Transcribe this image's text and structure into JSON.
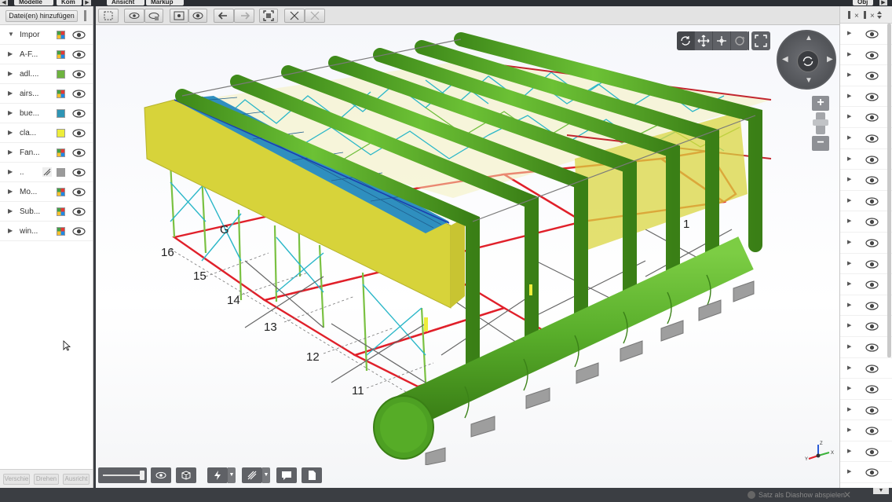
{
  "top_tabs": {
    "left_tab": "Modelle",
    "left_tab2": "Kom",
    "view_tab": "Ansicht",
    "markup_tab": "Markup",
    "right_tab": "Obj"
  },
  "left_panel": {
    "add_files_label": "Datei(en) hinzufügen",
    "items": [
      {
        "label": "Impor",
        "expanded": true,
        "swatch": "multi",
        "color": ""
      },
      {
        "label": "A-F...",
        "expanded": false,
        "swatch": "multi",
        "color": ""
      },
      {
        "label": "adl....",
        "expanded": false,
        "swatch": "solid",
        "color": "#6db33f"
      },
      {
        "label": "airs...",
        "expanded": false,
        "swatch": "multi",
        "color": ""
      },
      {
        "label": "bue...",
        "expanded": false,
        "swatch": "solid",
        "color": "#2e95b5"
      },
      {
        "label": "cla...",
        "expanded": false,
        "swatch": "solid",
        "color": "#eded3a"
      },
      {
        "label": "Fan...",
        "expanded": false,
        "swatch": "multi",
        "color": ""
      },
      {
        "label": "..",
        "expanded": false,
        "swatch": "solid",
        "color": "#9a9a9a"
      },
      {
        "label": "Mo...",
        "expanded": false,
        "swatch": "multi",
        "color": ""
      },
      {
        "label": "Sub...",
        "expanded": false,
        "swatch": "multi",
        "color": ""
      },
      {
        "label": "win...",
        "expanded": false,
        "swatch": "multi",
        "color": ""
      }
    ],
    "bottom_buttons": [
      "Verschie",
      "Drehen",
      "Ausricht"
    ]
  },
  "viewport": {
    "grid_labels": [
      "16",
      "15",
      "14",
      "13",
      "12",
      "11",
      "G",
      "1"
    ],
    "triad_labels": [
      "Z",
      "X",
      "Y"
    ]
  },
  "right_panel": {
    "row_count": 22
  },
  "status_bar": {
    "slideshow_label": "Satz als Diashow abspielen"
  },
  "colors": {
    "pipe_green": "#58ad2a",
    "wall_yellow": "#d9d53a",
    "roof_blue": "#2f8fbf",
    "beam_red": "#e0202a",
    "brace_cyan": "#2bb7c8",
    "column_green": "#7ac142"
  }
}
